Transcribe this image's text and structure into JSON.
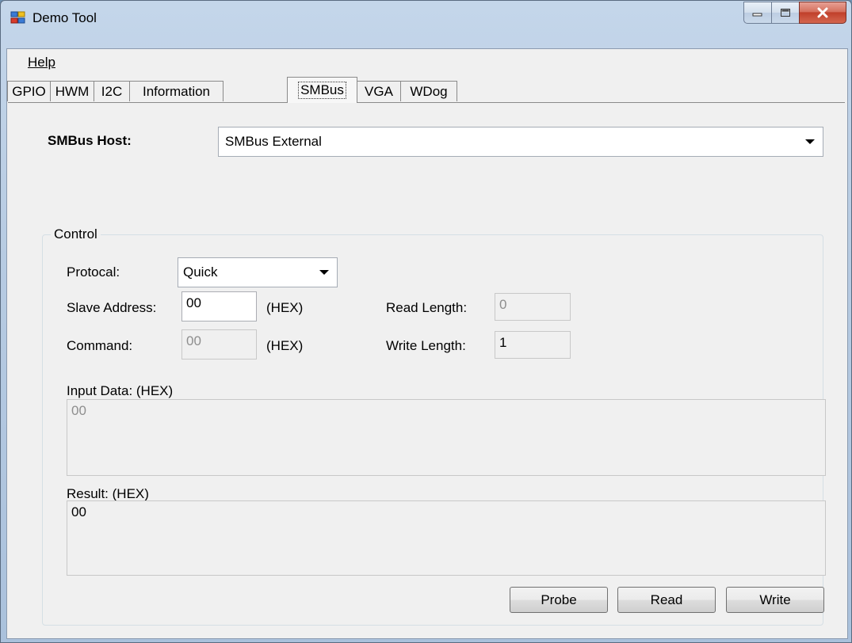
{
  "window": {
    "title": "Demo Tool"
  },
  "menu": {
    "help_label": "Help"
  },
  "tabs": [
    {
      "label": "GPIO"
    },
    {
      "label": "HWM"
    },
    {
      "label": "I2C"
    },
    {
      "label": "Information"
    },
    {
      "label": "SMBus"
    },
    {
      "label": "VGA"
    },
    {
      "label": "WDog"
    }
  ],
  "active_tab": "SMBus",
  "smbus": {
    "host_label": "SMBus Host:",
    "host_value": "SMBus External",
    "control_group": "Control",
    "protocol_label": "Protocal:",
    "protocol_value": "Quick",
    "slave_address_label": "Slave Address:",
    "slave_address_value": "00",
    "slave_address_unit": "(HEX)",
    "command_label": "Command:",
    "command_value": "00",
    "command_unit": "(HEX)",
    "read_length_label": "Read Length:",
    "read_length_value": "0",
    "write_length_label": "Write Length:",
    "write_length_value": "1",
    "input_data_label": "Input Data: (HEX)",
    "input_data_value": "00",
    "result_label": "Result: (HEX)",
    "result_value": "00",
    "probe_label": "Probe",
    "read_label": "Read",
    "write_label": "Write"
  },
  "colors": {
    "accent": "#c0402b",
    "window_frame": "#b7cbe2"
  }
}
